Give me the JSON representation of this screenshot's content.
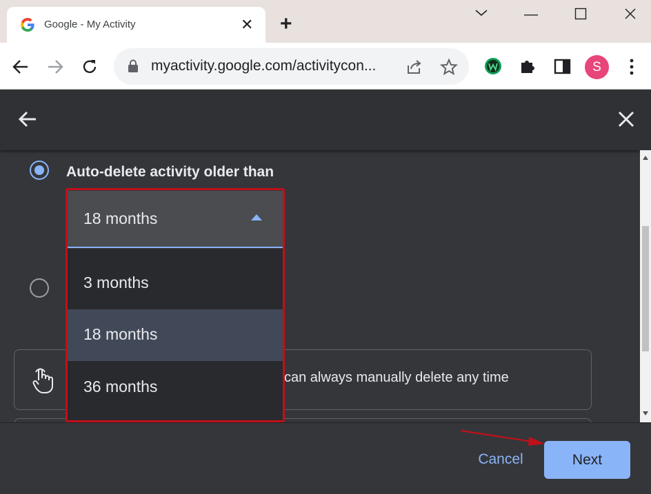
{
  "browser": {
    "tab_title": "Google - My Activity",
    "url": "myactivity.google.com/activitycon...",
    "profile_initial": "S"
  },
  "dialog": {
    "option_label": "Auto-delete activity older than",
    "select_value": "18 months",
    "menu_items": [
      {
        "label": "3 months",
        "selected": false
      },
      {
        "label": "18 months",
        "selected": true
      },
      {
        "label": "36 months",
        "selected": false
      }
    ],
    "info_text": "can always manually delete any time",
    "cancel_label": "Cancel",
    "next_label": "Next"
  },
  "colors": {
    "accent": "#8ab4f8",
    "page_bg": "#35363a",
    "annotation_red": "#c0101a"
  }
}
